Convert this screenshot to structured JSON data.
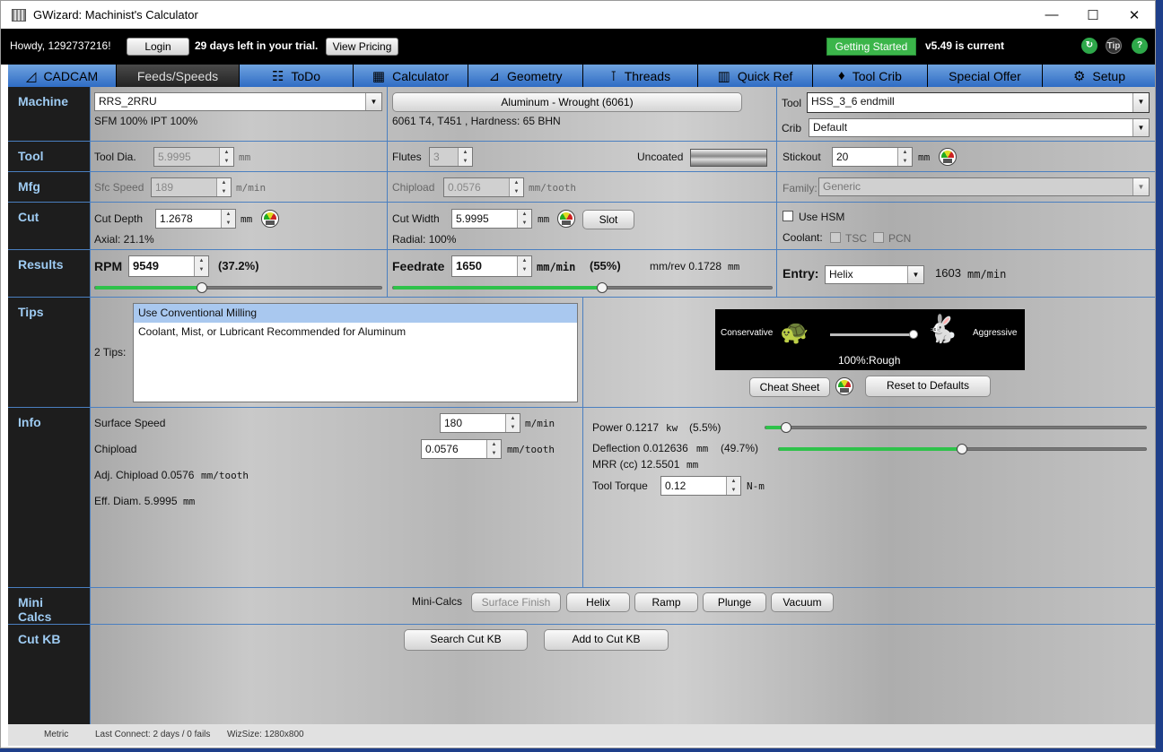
{
  "window": {
    "title": "GWizard: Machinist's Calculator",
    "min": "—",
    "max": "☐",
    "close": "✕"
  },
  "topbar": {
    "greeting": "Howdy, 1292737216!",
    "login": "Login",
    "trial": "29 days left in your trial.",
    "pricing": "View Pricing",
    "getting_started": "Getting Started",
    "version": "v5.49 is current",
    "tip": "Tip",
    "help": "?"
  },
  "tabs": [
    {
      "label": "CADCAM",
      "icon": "◿"
    },
    {
      "label": "Feeds/Speeds",
      "icon": ""
    },
    {
      "label": "ToDo",
      "icon": "☷"
    },
    {
      "label": "Calculator",
      "icon": "▦"
    },
    {
      "label": "Geometry",
      "icon": "⊿"
    },
    {
      "label": "Threads",
      "icon": "⊺"
    },
    {
      "label": "Quick Ref",
      "icon": "▥"
    },
    {
      "label": "Tool Crib",
      "icon": "♦"
    },
    {
      "label": "Special Offer",
      "icon": ""
    },
    {
      "label": "Setup",
      "icon": "⚙"
    }
  ],
  "sections": {
    "machine": "Machine",
    "tool": "Tool",
    "mfg": "Mfg",
    "cut": "Cut",
    "results": "Results",
    "tips": "Tips",
    "info": "Info",
    "mini1": "Mini",
    "mini2": "Calcs",
    "cutkb": "Cut KB"
  },
  "machine": {
    "name": "RRS_2RRU",
    "sfm_ipt": "SFM 100%  IPT 100%",
    "material": "Aluminum - Wrought (6061)",
    "material_desc": "6061 T4, T451 , Hardness: 65 BHN",
    "tool_label": "Tool",
    "tool_value": "HSS_3_6 endmill",
    "crib_label": "Crib",
    "crib_value": "Default"
  },
  "tool": {
    "dia_label": "Tool Dia.",
    "dia": "5.9995",
    "dia_unit": "mm",
    "flutes_label": "Flutes",
    "flutes": "3",
    "coating": "Uncoated",
    "stickout_label": "Stickout",
    "stickout": "20",
    "stickout_unit": "mm"
  },
  "mfg": {
    "sfc_label": "Sfc Speed",
    "sfc": "189",
    "sfc_unit": "m/min",
    "chip_label": "Chipload",
    "chip": "0.0576",
    "chip_unit": "mm/tooth",
    "family_label": "Family:",
    "family": "Generic"
  },
  "cut": {
    "depth_label": "Cut Depth",
    "depth": "1.2678",
    "depth_unit": "mm",
    "axial": "Axial: 21.1%",
    "width_label": "Cut Width",
    "width": "5.9995",
    "width_unit": "mm",
    "slot": "Slot",
    "radial": "Radial: 100%",
    "hsm": "Use HSM",
    "coolant": "Coolant:",
    "tsc": "TSC",
    "pcn": "PCN"
  },
  "results": {
    "rpm_label": "RPM",
    "rpm": "9549",
    "rpm_pct": "(37.2%)",
    "rpm_slider": 0.372,
    "feed_label": "Feedrate",
    "feed": "1650",
    "feed_unit": "mm/min",
    "feed_pct": "(55%)",
    "mmrev_label": "mm/rev 0.1728",
    "mmrev_unit": "mm",
    "feed_slider": 0.55,
    "entry_label": "Entry:",
    "entry": "Helix",
    "entry_rate": "1603",
    "entry_unit": "mm/min"
  },
  "tips": {
    "count": "2 Tips:",
    "items": [
      "Use Conventional Milling",
      "Coolant, Mist, or Lubricant Recommended for Aluminum"
    ],
    "conservative": "Conservative",
    "aggressive": "Aggressive",
    "mode": "100%:Rough",
    "cheat": "Cheat Sheet",
    "reset": "Reset to Defaults"
  },
  "info": {
    "surface_label": "Surface Speed",
    "surface": "180",
    "surface_unit": "m/min",
    "chip_label": "Chipload",
    "chip": "0.0576",
    "chip_unit": "mm/tooth",
    "adj_label": "Adj. Chipload 0.0576",
    "adj_unit": "mm/tooth",
    "eff_label": "Eff. Diam. 5.9995",
    "eff_unit": "mm",
    "power_label": "Power 0.1217",
    "power_unit": "kw",
    "power_pct": "(5.5%)",
    "power_slider": 0.055,
    "defl_label": "Deflection 0.012636",
    "defl_unit": "mm",
    "defl_pct": "(49.7%)",
    "defl_slider": 0.497,
    "mrr_label": "MRR (cc) 12.5501",
    "mrr_unit": "mm",
    "torque_label": "Tool Torque",
    "torque": "0.12",
    "torque_unit": "N-m"
  },
  "mini": {
    "label": "Mini-Calcs",
    "surface": "Surface Finish",
    "helix": "Helix",
    "ramp": "Ramp",
    "plunge": "Plunge",
    "vacuum": "Vacuum"
  },
  "cutkb": {
    "search": "Search Cut KB",
    "add": "Add to Cut KB"
  },
  "status": {
    "units": "Metric",
    "connect": "Last Connect: 2 days / 0 fails",
    "size": "WizSize: 1280x800"
  }
}
